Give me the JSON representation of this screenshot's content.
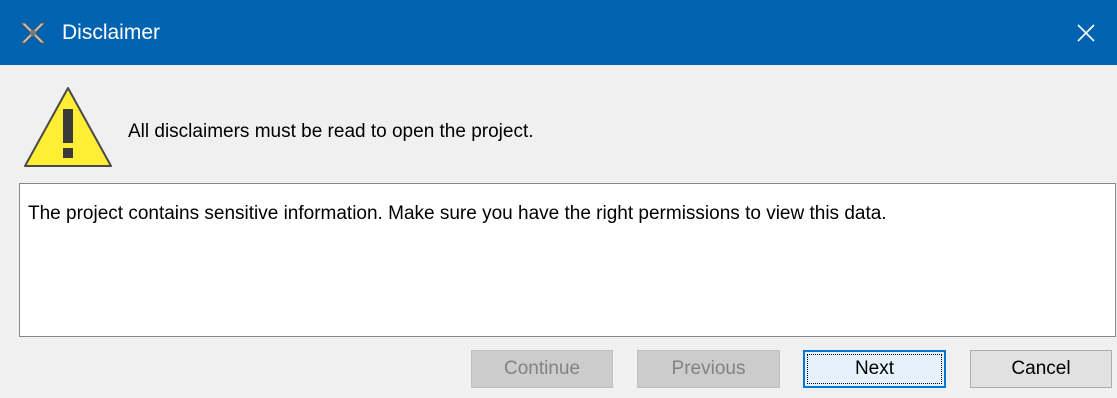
{
  "window": {
    "title": "Disclaimer",
    "app_icon": "satellite-app-icon",
    "close_icon": "close-icon",
    "titlebar_color": "#0063b1"
  },
  "header": {
    "icon": "warning-icon",
    "message": "All disclaimers must be read to open the project."
  },
  "disclaimer": {
    "text": "The project contains sensitive information. Make sure you have the right permissions to view this data."
  },
  "buttons": {
    "continue": "Continue",
    "previous": "Previous",
    "next": "Next",
    "cancel": "Cancel"
  }
}
